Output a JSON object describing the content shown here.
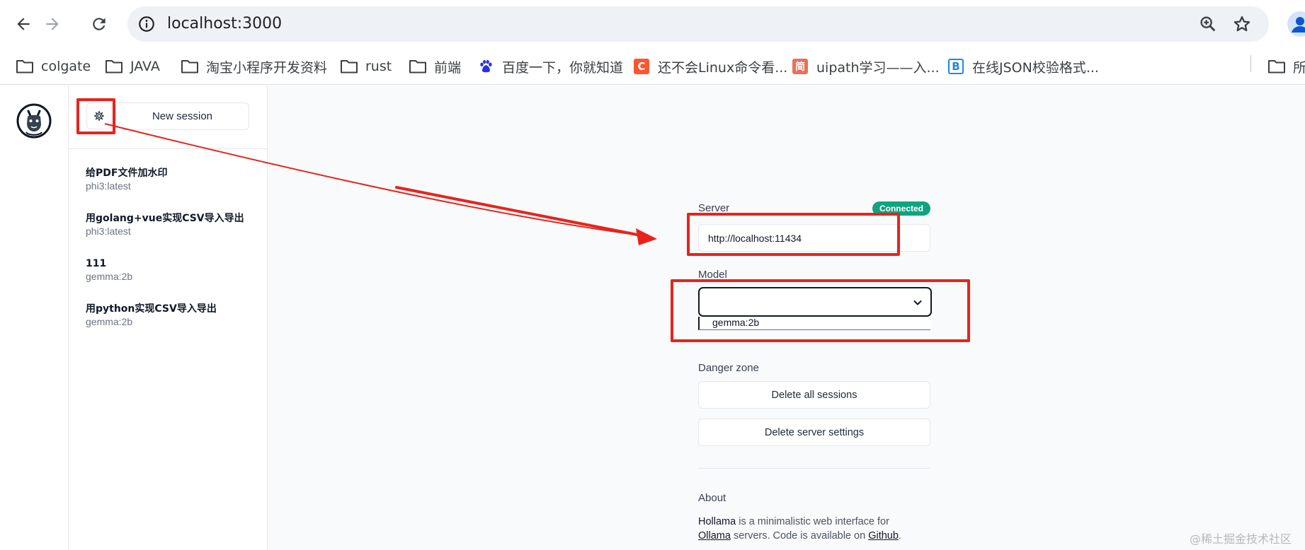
{
  "browser": {
    "url": "localhost:3000",
    "bookmarks": [
      {
        "label": "colgate",
        "icon": "folder-icon"
      },
      {
        "label": "JAVA",
        "icon": "folder-icon"
      },
      {
        "label": "淘宝小程序开发资料",
        "icon": "folder-icon"
      },
      {
        "label": "rust",
        "icon": "folder-icon"
      },
      {
        "label": "前端",
        "icon": "folder-icon"
      },
      {
        "label": "百度一下，你就知道",
        "icon": "baidu-paw-icon"
      },
      {
        "label": "还不会Linux命令看...",
        "icon": "csdn-icon",
        "glyph": "C"
      },
      {
        "label": "uipath学习——入...",
        "icon": "jianshu-icon",
        "glyph": "简"
      },
      {
        "label": "在线JSON校验格式...",
        "icon": "bejson-icon",
        "glyph": "B"
      },
      {
        "label": "所",
        "icon": "folder-icon"
      }
    ]
  },
  "sidebar": {
    "new_session_label": "New session",
    "sessions": [
      {
        "title": "给PDF文件加水印",
        "model": "phi3:latest"
      },
      {
        "title": "用golang+vue实现CSV导入导出",
        "model": "phi3:latest"
      },
      {
        "title": "111",
        "model": "gemma:2b"
      },
      {
        "title": "用python实现CSV导入导出",
        "model": "gemma:2b"
      }
    ]
  },
  "settings": {
    "server_label": "Server",
    "status_badge": "Connected",
    "server_value": "http://localhost:11434",
    "model_label": "Model",
    "model_selected": "",
    "model_option": "gemma:2b",
    "danger_label": "Danger zone",
    "delete_sessions_label": "Delete all sessions",
    "delete_settings_label": "Delete server settings",
    "about_label": "About",
    "about": {
      "name": "Hollama",
      "text1": " is a minimalistic web interface for",
      "ollama": "Ollama",
      "text2": " servers. Code is available on ",
      "github": "Github",
      "text3": "."
    }
  },
  "watermark": "@稀土掘金技术社区",
  "colors": {
    "annotation": "#e8231c",
    "connected": "#10a37f",
    "csdn": "#fc5531",
    "jianshu": "#ea6f5a",
    "bejson": "#1e88e5",
    "baidu": "#2932e1"
  }
}
